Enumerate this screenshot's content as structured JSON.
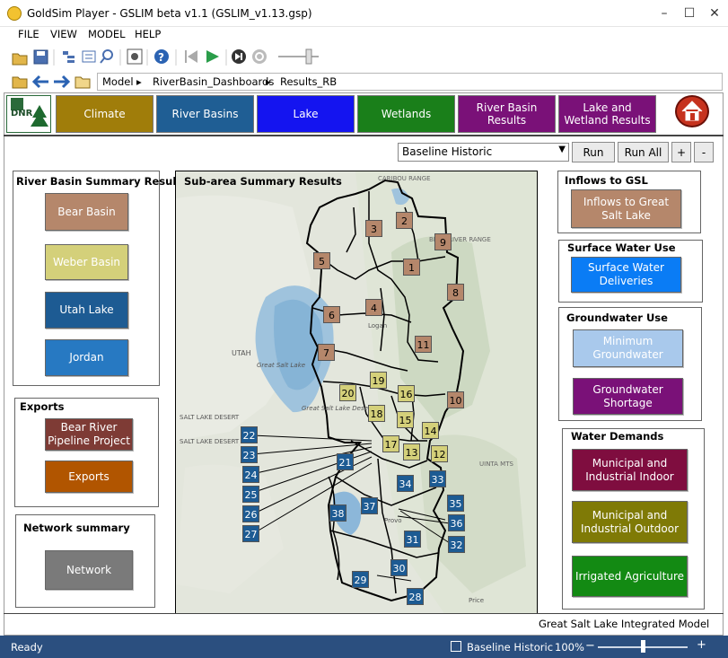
{
  "window": {
    "title": "GoldSim Player - GSLIM beta v1.1 (GSLIM_v1.13.gsp)"
  },
  "menu": [
    "FILE",
    "VIEW",
    "MODEL",
    "HELP"
  ],
  "breadcrumb": [
    "Model",
    "RiverBasin_Dashboards",
    "Results_RB"
  ],
  "tabs": [
    {
      "label": "Climate",
      "color": "#a07d0a"
    },
    {
      "label": "River Basins",
      "color": "#1f5e94"
    },
    {
      "label": "Lake",
      "color": "#1414f0"
    },
    {
      "label": "Wetlands",
      "color": "#1a7f1a"
    },
    {
      "label": "River Basin Results",
      "color": "#7a1178"
    },
    {
      "label": "Lake and Wetland Results",
      "color": "#7a1178"
    }
  ],
  "logo": "DNR",
  "scenario": {
    "selected": "Baseline Historic",
    "run_label": "Run",
    "run_all_label": "Run All",
    "plus": "+",
    "minus": "-"
  },
  "rb_summary": {
    "title": "River Basin Summary Results",
    "buttons": [
      {
        "label": "Bear Basin",
        "color": "#b5876b",
        "text": "#ffffff"
      },
      {
        "label": "Weber Basin",
        "color": "#d4d07a",
        "text": "#ffffff"
      },
      {
        "label": "Utah Lake",
        "color": "#1d5b93",
        "text": "#ffffff"
      },
      {
        "label": "Jordan",
        "color": "#2779c2",
        "text": "#ffffff"
      }
    ]
  },
  "exports": {
    "title": "Exports",
    "buttons": [
      {
        "label": "Bear River Pipeline Project",
        "color": "#7e3b35"
      },
      {
        "label": "Exports",
        "color": "#b15500"
      }
    ]
  },
  "network": {
    "title": "Network summary",
    "button": "Network"
  },
  "map": {
    "title": "Sub-area Summary Results",
    "labels": [
      "1",
      "2",
      "3",
      "4",
      "5",
      "6",
      "7",
      "8",
      "9",
      "10",
      "11",
      "12",
      "13",
      "14",
      "15",
      "16",
      "17",
      "18",
      "19",
      "20",
      "21",
      "22",
      "23",
      "24",
      "25",
      "26",
      "27",
      "28",
      "29",
      "30",
      "31",
      "32",
      "33",
      "34",
      "35",
      "36",
      "37",
      "38"
    ],
    "place_names": [
      "UTAH",
      "Great Salt Lake",
      "SALT LAKE DESERT",
      "SALT LAKE DESERT",
      "Great Salt Lake Desert",
      "Logan",
      "Provo",
      "Price",
      "CARIBOU RANGE",
      "BEAR RIVER RANGE",
      "UINTA MTS"
    ]
  },
  "right": {
    "inflows": {
      "title": "Inflows to GSL",
      "button": "Inflows to Great Salt Lake",
      "color": "#b5876b"
    },
    "surface": {
      "title": "Surface Water Use",
      "button": "Surface Water Deliveries",
      "color": "#0a7cf5"
    },
    "ground": {
      "title": "Groundwater Use",
      "buttons": [
        {
          "label": "Minimum Groundwater",
          "color": "#a9c9ec"
        },
        {
          "label": "Groundwater Shortage",
          "color": "#7a1178"
        }
      ]
    },
    "demands": {
      "title": "Water Demands",
      "buttons": [
        {
          "label": "Municipal and Industrial Indoor",
          "color": "#7f0d3f"
        },
        {
          "label": "Municipal and Industrial Outdoor",
          "color": "#7f7a06"
        },
        {
          "label": "Irrigated Agriculture",
          "color": "#138a13"
        }
      ]
    }
  },
  "footer": "Great Salt Lake Integrated Model",
  "status": {
    "ready": "Ready",
    "scenario": "Baseline Historic",
    "zoom": "100%",
    "zoom_level": 0.5
  }
}
